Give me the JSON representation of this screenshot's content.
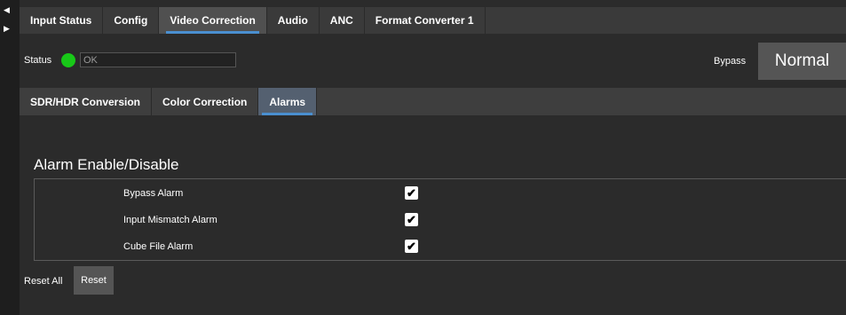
{
  "nav": {
    "left_glyph": "◀",
    "right_glyph": "▶"
  },
  "top_tabs": [
    {
      "label": "Input Status",
      "active": false
    },
    {
      "label": "Config",
      "active": false
    },
    {
      "label": "Video Correction",
      "active": true
    },
    {
      "label": "Audio",
      "active": false
    },
    {
      "label": "ANC",
      "active": false
    },
    {
      "label": "Format Converter 1",
      "active": false
    }
  ],
  "status": {
    "label": "Status",
    "value": "OK",
    "led_color": "#18c818"
  },
  "bypass": {
    "label": "Bypass",
    "button_label": "Normal"
  },
  "sub_tabs": [
    {
      "label": "SDR/HDR Conversion",
      "active": false
    },
    {
      "label": "Color Correction",
      "active": false
    },
    {
      "label": "Alarms",
      "active": true
    }
  ],
  "section": {
    "title": "Alarm Enable/Disable"
  },
  "alarms": [
    {
      "label": "Bypass Alarm",
      "checked": true,
      "check_glyph": "✔"
    },
    {
      "label": "Input Mismatch Alarm",
      "checked": true,
      "check_glyph": "✔"
    },
    {
      "label": "Cube File Alarm",
      "checked": true,
      "check_glyph": "✔"
    }
  ],
  "reset": {
    "label": "Reset All",
    "button_label": "Reset"
  },
  "colors": {
    "accent": "#4a8fd0",
    "background": "#2b2b2b",
    "tab_bar": "#3a3a3a"
  }
}
